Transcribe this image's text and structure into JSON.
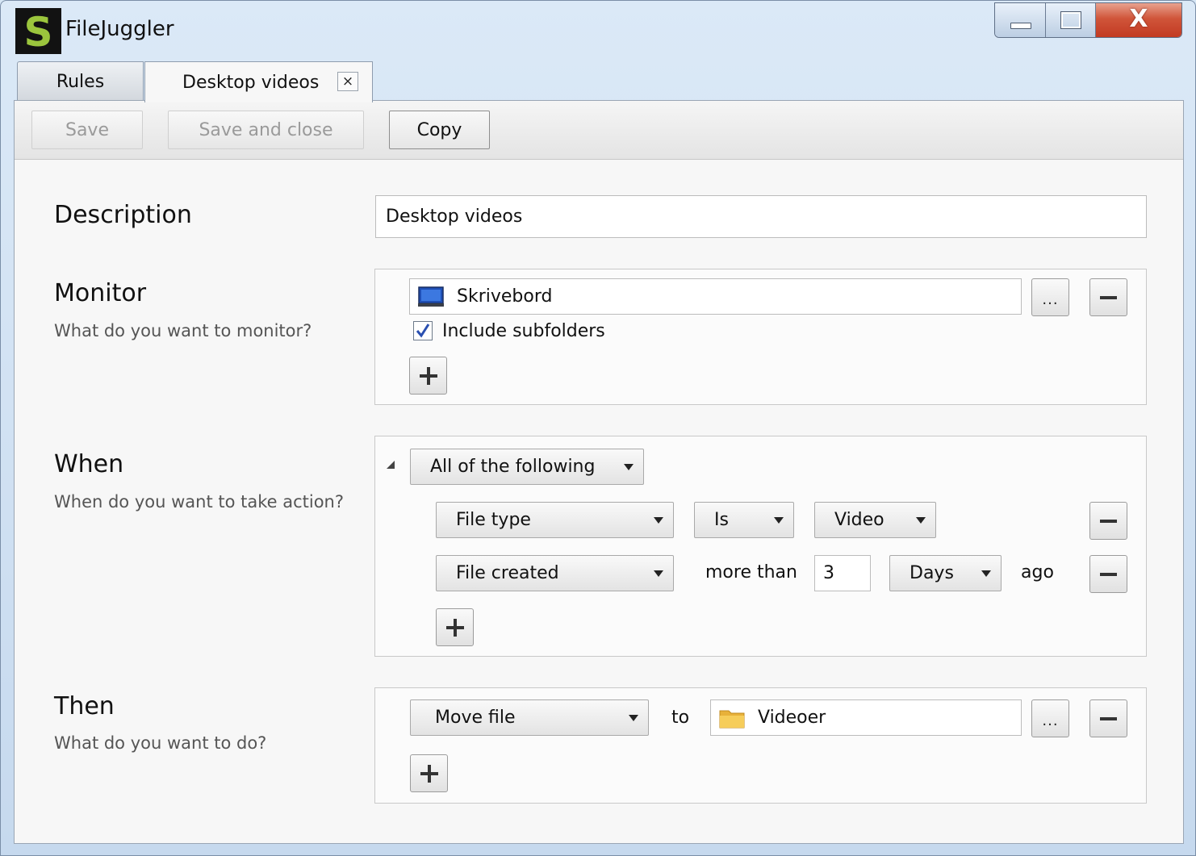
{
  "window": {
    "app_title": "FileJuggler",
    "icon_letter": "S",
    "close_glyph": "X"
  },
  "tabs": [
    {
      "label": "Rules"
    },
    {
      "label": "Desktop videos",
      "close_glyph": "×"
    }
  ],
  "toolbar": {
    "save_label": "Save",
    "save_close_label": "Save and close",
    "copy_label": "Copy"
  },
  "description": {
    "title": "Description",
    "value": "Desktop videos"
  },
  "monitor": {
    "title": "Monitor",
    "subtitle": "What do you want to monitor?",
    "folder": "Skrivebord",
    "include_subfolders_label": "Include subfolders",
    "include_subfolders_checked": true,
    "browse_label": "..."
  },
  "when": {
    "title": "When",
    "subtitle": "When do you want to take action?",
    "group_mode": "All of the following",
    "conditions": [
      {
        "field": "File type",
        "operator": "Is",
        "value": "Video"
      },
      {
        "field": "File created",
        "operator_text": "more than",
        "amount": "3",
        "unit": "Days",
        "suffix": "ago"
      }
    ]
  },
  "then": {
    "title": "Then",
    "subtitle": "What do you want to do?",
    "action": "Move file",
    "to_label": "to",
    "destination": "Videoer",
    "browse_label": "..."
  },
  "colors": {
    "icon_green": "#9bc53d",
    "close_red": "#c9452b",
    "checkbox_blue": "#2a4fb0"
  }
}
